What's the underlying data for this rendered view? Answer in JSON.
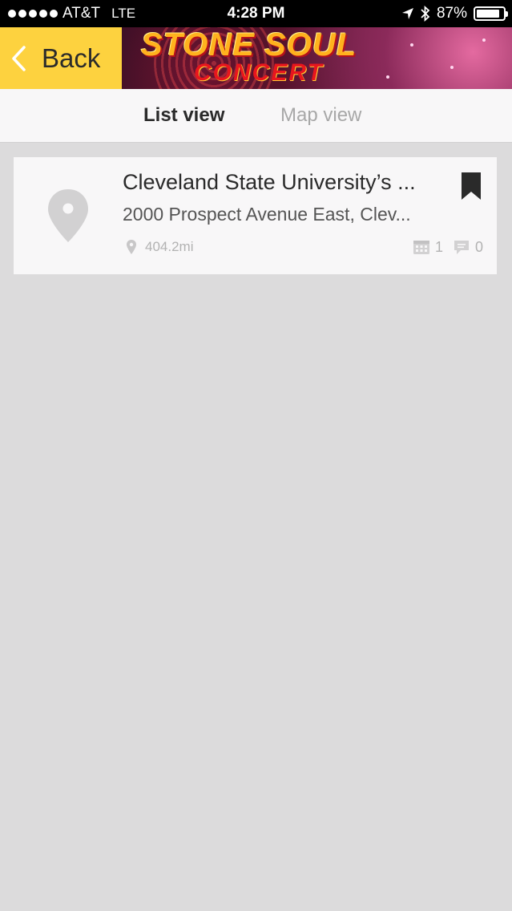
{
  "status_bar": {
    "carrier": "AT&T",
    "network": "LTE",
    "time": "4:28 PM",
    "battery": "87%",
    "battery_level": 0.87
  },
  "header": {
    "back_label": "Back",
    "banner_line1": "Stone Soul",
    "banner_line2": "CONCERT"
  },
  "tabs": [
    {
      "label": "List view",
      "active": true
    },
    {
      "label": "Map view",
      "active": false
    }
  ],
  "venues": [
    {
      "name": "Cleveland State University’s ...",
      "address": "2000 Prospect Avenue East, Clev...",
      "distance": "404.2mi",
      "events_count": "1",
      "comments_count": "0",
      "bookmarked": true
    }
  ],
  "colors": {
    "accent": "#fdd23f",
    "background": "#dcdbdc",
    "card": "#f8f7f8",
    "muted": "#b2b2b2"
  },
  "icons": [
    "back-chevron-icon",
    "location-arrow-icon",
    "bluetooth-icon",
    "battery-icon",
    "map-pin-icon",
    "bookmark-icon",
    "calendar-icon",
    "comment-icon"
  ]
}
